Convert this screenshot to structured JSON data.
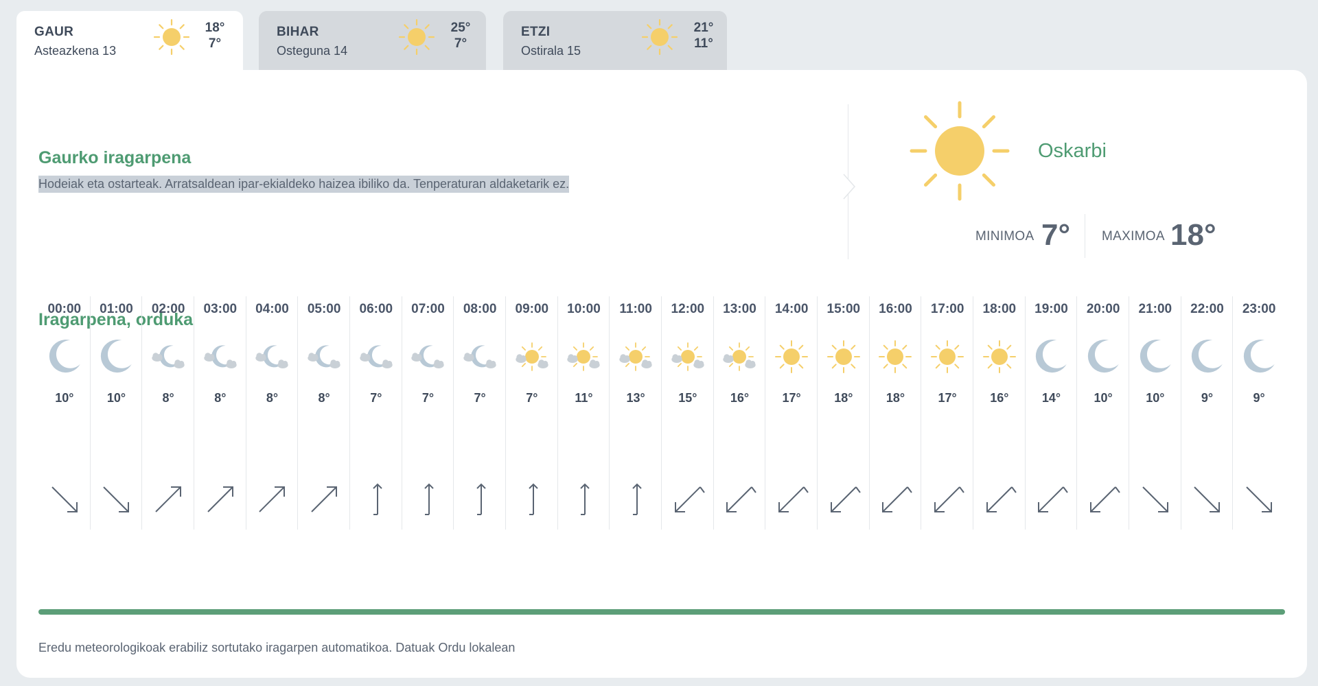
{
  "tabs": [
    {
      "day": "GAUR",
      "date": "Asteazkena 13",
      "icon": "sun-icon",
      "high": "18°",
      "low": "7°",
      "active": true
    },
    {
      "day": "BIHAR",
      "date": "Osteguna 14",
      "icon": "sun-icon",
      "high": "25°",
      "low": "7°",
      "active": false
    },
    {
      "day": "ETZI",
      "date": "Ostirala 15",
      "icon": "sun-icon",
      "high": "21°",
      "low": "11°",
      "active": false
    }
  ],
  "today": {
    "title": "Gaurko iragarpena",
    "description": "Hodeiak eta ostarteak. Arratsaldean ipar-ekialdeko haizea ibiliko da. Tenperaturan aldaketarik ez.",
    "condition": "Oskarbi",
    "min_label": "MINIMOA",
    "min_value": "7°",
    "max_label": "MAXIMOA",
    "max_value": "18°"
  },
  "hourly": {
    "title": "Iragarpena, orduka",
    "hours": [
      {
        "time": "00:00",
        "icon": "moon-icon",
        "temp": "10°",
        "wind": "nw"
      },
      {
        "time": "01:00",
        "icon": "moon-icon",
        "temp": "10°",
        "wind": "nw"
      },
      {
        "time": "02:00",
        "icon": "moon-cloud-icon",
        "temp": "8°",
        "wind": "sw"
      },
      {
        "time": "03:00",
        "icon": "moon-cloud-icon",
        "temp": "8°",
        "wind": "sw"
      },
      {
        "time": "04:00",
        "icon": "moon-cloud-icon",
        "temp": "8°",
        "wind": "sw"
      },
      {
        "time": "05:00",
        "icon": "moon-cloud-icon",
        "temp": "8°",
        "wind": "sw"
      },
      {
        "time": "06:00",
        "icon": "moon-cloud-icon",
        "temp": "7°",
        "wind": "s"
      },
      {
        "time": "07:00",
        "icon": "moon-cloud-icon",
        "temp": "7°",
        "wind": "s"
      },
      {
        "time": "08:00",
        "icon": "moon-cloud-icon",
        "temp": "7°",
        "wind": "s"
      },
      {
        "time": "09:00",
        "icon": "sun-cloud-icon",
        "temp": "7°",
        "wind": "s"
      },
      {
        "time": "10:00",
        "icon": "sun-cloud-icon",
        "temp": "11°",
        "wind": "s"
      },
      {
        "time": "11:00",
        "icon": "sun-cloud-icon",
        "temp": "13°",
        "wind": "s"
      },
      {
        "time": "12:00",
        "icon": "sun-cloud-icon",
        "temp": "15°",
        "wind": "ne"
      },
      {
        "time": "13:00",
        "icon": "sun-cloud-icon",
        "temp": "16°",
        "wind": "ne"
      },
      {
        "time": "14:00",
        "icon": "sun-icon",
        "temp": "17°",
        "wind": "ne"
      },
      {
        "time": "15:00",
        "icon": "sun-icon",
        "temp": "18°",
        "wind": "ne"
      },
      {
        "time": "16:00",
        "icon": "sun-icon",
        "temp": "18°",
        "wind": "ne"
      },
      {
        "time": "17:00",
        "icon": "sun-icon",
        "temp": "17°",
        "wind": "ne"
      },
      {
        "time": "18:00",
        "icon": "sun-icon",
        "temp": "16°",
        "wind": "ne"
      },
      {
        "time": "19:00",
        "icon": "moon-icon",
        "temp": "14°",
        "wind": "ne"
      },
      {
        "time": "20:00",
        "icon": "moon-icon",
        "temp": "10°",
        "wind": "ne"
      },
      {
        "time": "21:00",
        "icon": "moon-icon",
        "temp": "10°",
        "wind": "nw"
      },
      {
        "time": "22:00",
        "icon": "moon-icon",
        "temp": "9°",
        "wind": "nw"
      },
      {
        "time": "23:00",
        "icon": "moon-icon",
        "temp": "9°",
        "wind": "nw"
      }
    ]
  },
  "footer": "Eredu meteorologikoak erabiliz sortutako iragarpen automatikoa. Datuak Ordu lokalean",
  "colors": {
    "accent": "#4e9b72",
    "sun": "#f5cf6a",
    "moon": "#b8c9d6",
    "cloud": "#c9d0d6"
  }
}
